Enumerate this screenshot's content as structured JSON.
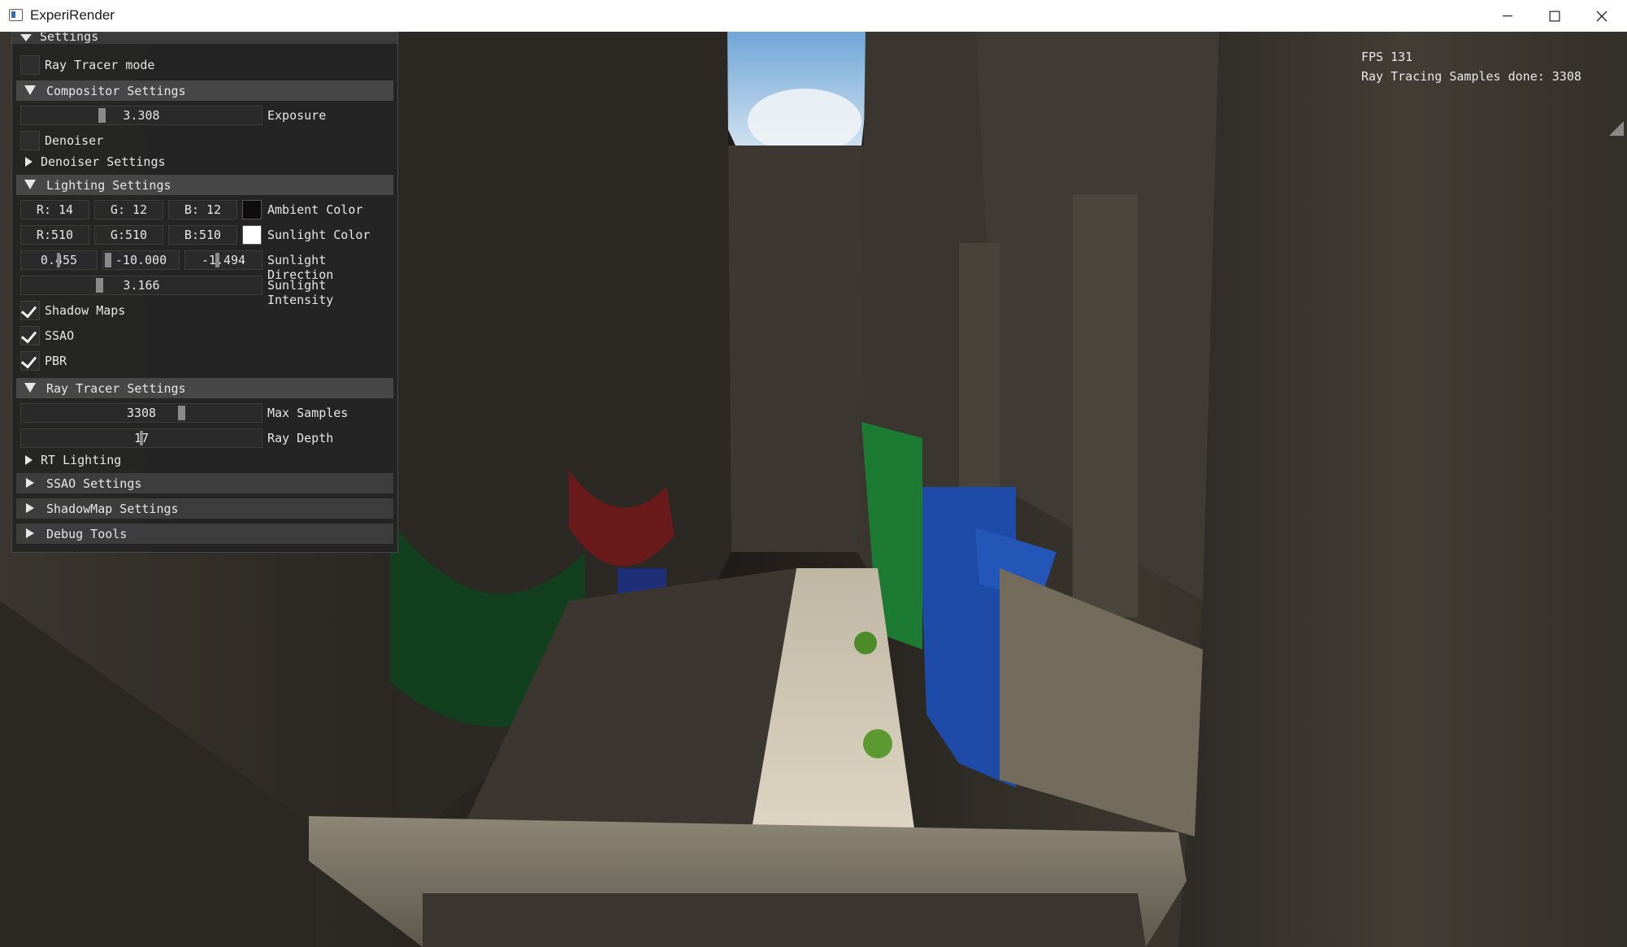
{
  "window": {
    "title": "ExperiRender",
    "controls": [
      "minimize-icon",
      "maximize-icon",
      "close-icon"
    ]
  },
  "hud": {
    "fps": "FPS 131",
    "samples": "Ray Tracing Samples done: 3308"
  },
  "settings": {
    "title": "Settings",
    "ray_tracer_mode": {
      "label": "Ray Tracer mode",
      "checked": false
    },
    "compositor": {
      "header": "Compositor Settings",
      "exposure": {
        "value": "3.308",
        "label": "Exposure"
      },
      "denoiser": {
        "label": "Denoiser",
        "checked": false
      },
      "denoiser_settings": "Denoiser Settings"
    },
    "lighting": {
      "header": "Lighting Settings",
      "ambient": {
        "r": "R: 14",
        "g": "G: 12",
        "b": "B: 12",
        "label": "Ambient Color",
        "color": "#0e0c0c"
      },
      "sunlight_color": {
        "r": "R:510",
        "g": "G:510",
        "b": "B:510",
        "label": "Sunlight Color",
        "color": "#ffffff"
      },
      "sunlight_direction": {
        "x": "0.455",
        "y": "-10.000",
        "z": "-1.494",
        "label": "Sunlight Direction"
      },
      "sunlight_intensity": {
        "value": "3.166",
        "label": "Sunlight Intensity"
      },
      "shadow_maps": {
        "label": "Shadow Maps",
        "checked": true
      },
      "ssao": {
        "label": "SSAO",
        "checked": true
      },
      "pbr": {
        "label": "PBR",
        "checked": true
      }
    },
    "ray_tracer": {
      "header": "Ray Tracer Settings",
      "max_samples": {
        "value": "3308",
        "label": "Max Samples"
      },
      "ray_depth": {
        "value": "17",
        "label": "Ray Depth"
      },
      "rt_lighting": "RT Lighting"
    },
    "ssao_settings": "SSAO Settings",
    "shadowmap_settings": "ShadowMap Settings",
    "debug_tools": "Debug Tools"
  },
  "colors": {
    "panel_bg": "#242424",
    "header_bg": "#474747",
    "title_bar": "#ffffff"
  }
}
